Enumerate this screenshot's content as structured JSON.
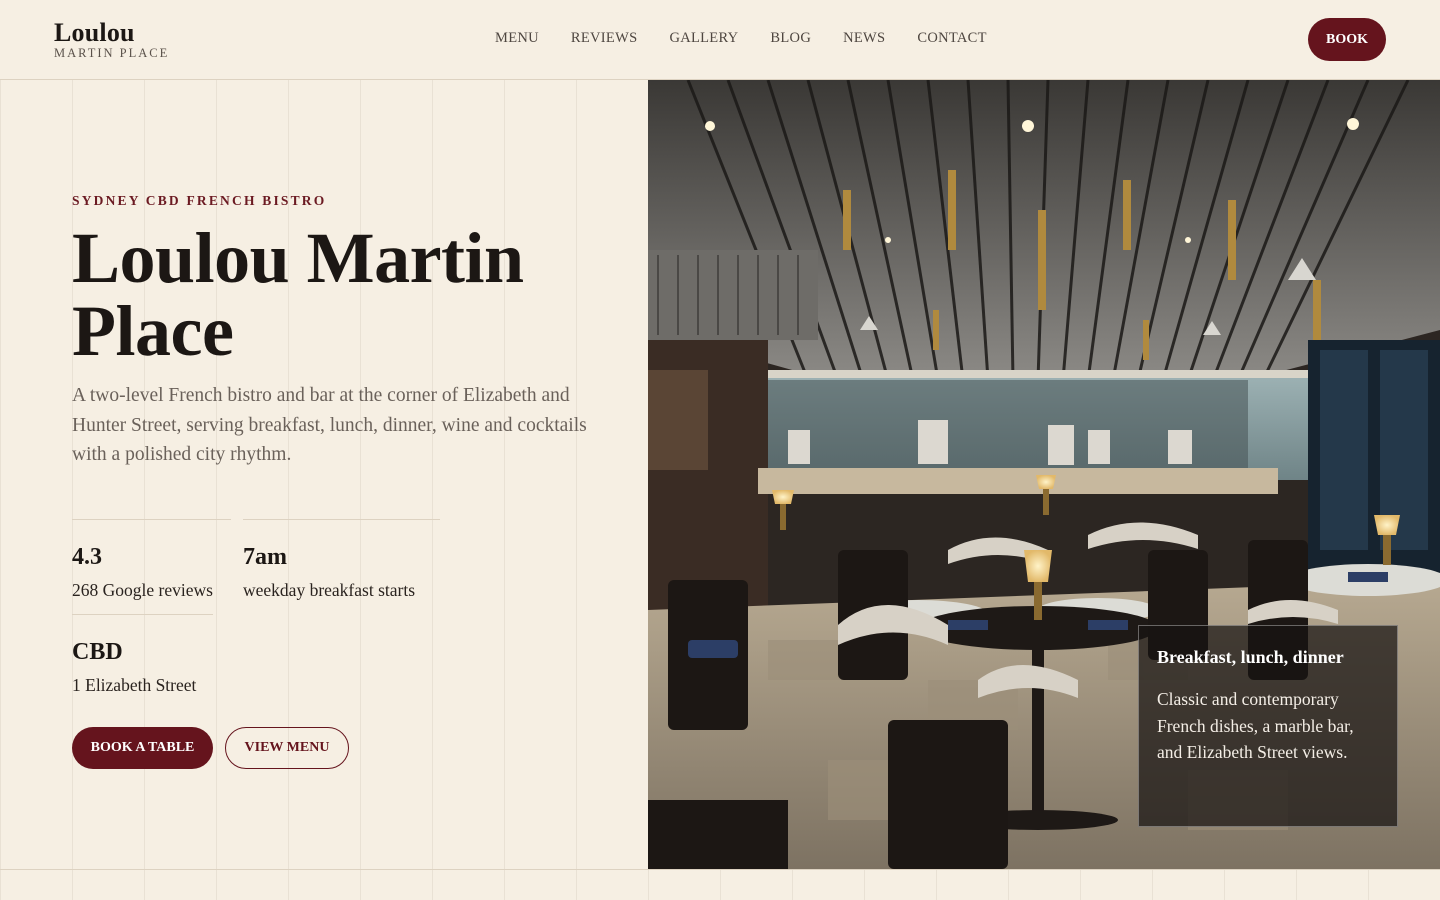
{
  "brand": {
    "name": "Loulou",
    "sub": "MARTIN PLACE"
  },
  "nav": {
    "items": [
      "MENU",
      "REVIEWS",
      "GALLERY",
      "BLOG",
      "NEWS",
      "CONTACT"
    ],
    "book_label": "BOOK"
  },
  "hero": {
    "eyebrow": "SYDNEY CBD FRENCH BISTRO",
    "title": "Loulou Martin Place",
    "lead": "A two-level French bistro and bar at the corner of Elizabeth and Hunter Street, serving breakfast, lunch, dinner, wine and cocktails with a polished city rhythm.",
    "stats": [
      {
        "value": "4.3",
        "label": "268 Google reviews"
      },
      {
        "value": "7am",
        "label": "weekday breakfast starts"
      },
      {
        "value": "CBD",
        "label": "1 Elizabeth Street"
      }
    ],
    "primary_cta": "BOOK A TABLE",
    "secondary_cta": "VIEW MENU"
  },
  "caption": {
    "title": "Breakfast, lunch, dinner",
    "body": "Classic and contemporary French dishes, a marble bar, and Elizabeth Street views."
  },
  "colors": {
    "accent": "#65141d",
    "background": "#f6efe3",
    "text": "#1c1714",
    "muted": "#6a615a"
  }
}
